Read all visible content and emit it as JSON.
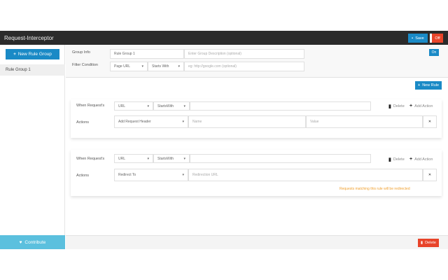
{
  "app": {
    "title": "Request-Interceptor",
    "save_label": "Save",
    "off_label": "Off"
  },
  "sidebar": {
    "new_group_label": "New Rule Group",
    "items": [
      {
        "label": "Rule Group 1"
      }
    ],
    "contribute_label": "Contribute"
  },
  "group": {
    "info_label": "Group Info",
    "name_value": "Rule Group 1",
    "description_placeholder": "Enter Group Description (optional)",
    "filter_label": "Filter Condition",
    "filter_field": "Page URL",
    "filter_operator": "Starts With",
    "filter_placeholder": "eg: http://google.com (optional)",
    "toggle_label": "On"
  },
  "new_rule_label": "New Rule",
  "rules": [
    {
      "when_label": "When Request's",
      "field": "URL",
      "operator": "StartsWith",
      "value": "",
      "delete_label": "Delete",
      "add_action_label": "Add Action",
      "actions_label": "Actions",
      "action": "Add Request Header",
      "name_placeholder": "Name",
      "value_placeholder": "Value"
    },
    {
      "when_label": "When Request's",
      "field": "URL",
      "operator": "StartsWith",
      "value": "",
      "delete_label": "Delete",
      "add_action_label": "Add Action",
      "actions_label": "Actions",
      "action": "Redirect To",
      "url_placeholder": "Redirection URL",
      "note": "Requests matching this rule will be redirected"
    }
  ],
  "footer": {
    "delete_label": "Delete"
  }
}
